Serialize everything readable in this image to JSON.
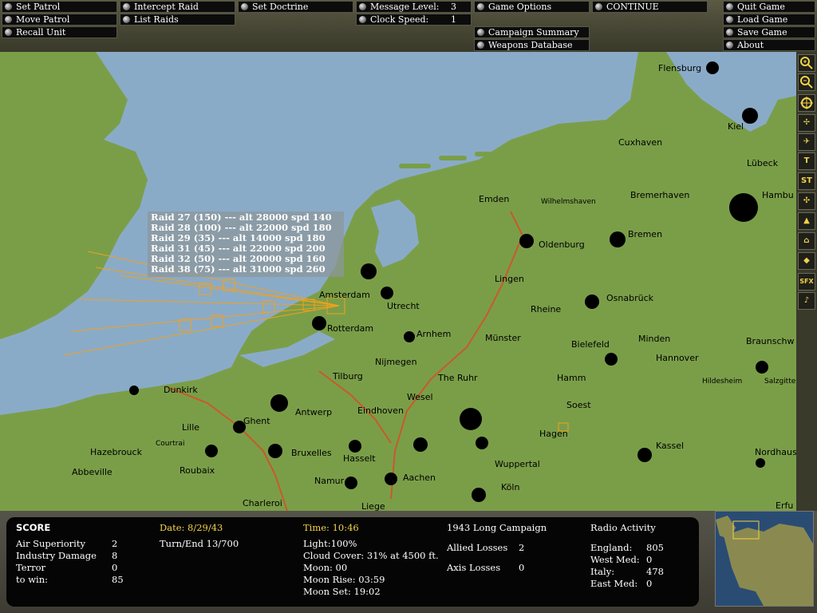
{
  "top_buttons": {
    "set_patrol": "Set Patrol",
    "move_patrol": "Move Patrol",
    "recall_unit": "Recall Unit",
    "intercept_raid": "Intercept Raid",
    "list_raids": "List Raids",
    "set_doctrine": "Set Doctrine",
    "message_level": "Message Level:",
    "message_level_value": "3",
    "clock_speed": "Clock Speed:",
    "clock_speed_value": "1",
    "game_options": "Game Options",
    "continue": "CONTINUE",
    "campaign_summary": "Campaign Summary",
    "weapons_database": "Weapons Database",
    "quit_game": "Quit Game",
    "load_game": "Load Game",
    "save_game": "Save Game",
    "about": "About"
  },
  "map": {
    "cities": {
      "flensburg": "Flensburg",
      "kiel": "Kiel",
      "lubeck": "Lübeck",
      "cuxhaven": "Cuxhaven",
      "hamburg": "Hambu",
      "emden": "Emden",
      "wilhelmshaven": "Wilhelmshaven",
      "bremerhaven": "Bremerhaven",
      "bremen": "Bremen",
      "oldenburg": "Oldenburg",
      "lingen": "Lingen",
      "amsterdam": "Amsterdam",
      "utrecht": "Utrecht",
      "rheine": "Rheine",
      "osnabruck": "Osnabrück",
      "rotterdam": "Rotterdam",
      "arnhem": "Arnhem",
      "munster": "Münster",
      "bielefeld": "Bielefeld",
      "minden": "Minden",
      "braunschweig": "Braunschw",
      "hannover": "Hannover",
      "nijmegen": "Nijmegen",
      "tilburg": "Tilburg",
      "the_ruhr": "The Ruhr",
      "hamm": "Hamm",
      "hildesheim": "Hildesheim",
      "salzgitter": "Salzgitter",
      "dunkirk": "Dunkirk",
      "antwerp": "Antwerp",
      "wesel": "Wesel",
      "eindhoven": "Eindhoven",
      "soest": "Soest",
      "ghent": "Ghent",
      "lille": "Lille",
      "courtrai": "Courtrai",
      "hagen": "Hagen",
      "hazebrouck": "Hazebrouck",
      "bruxelles": "Bruxelles",
      "kassel": "Kassel",
      "roubaix": "Roubaix",
      "hasselt": "Hasselt",
      "wuppertal": "Wuppertal",
      "abbeville": "Abbeville",
      "aachen": "Aachen",
      "nordhausen": "Nordhausen",
      "namur": "Namur",
      "koln": "Köln",
      "charleroi": "Charleroi",
      "liege": "Liege",
      "erfurt": "Erfu"
    }
  },
  "raids": [
    "Raid 27 (150)  --- alt 28000  spd 140",
    "Raid 28 (100)  --- alt 22000  spd 180",
    "Raid 29 (35)  --- alt 14000  spd 180",
    "Raid 31 (45)  --- alt 22000  spd 200",
    "Raid 32 (50)  --- alt 20000  spd 160",
    "Raid 38 (75)  --- alt 31000  spd 260"
  ],
  "sidebar": {
    "zoom_in_icon": "zoom-in-icon",
    "zoom_out_icon": "zoom-out-icon",
    "t_label": "T",
    "st_label": "ST",
    "sfx_label": "SFX"
  },
  "info": {
    "score_title": "SCORE",
    "air_superiority_label": "Air Superiority",
    "air_superiority_value": "2",
    "industry_damage_label": "Industry Damage",
    "industry_damage_value": "8",
    "terror_label": "Terror",
    "terror_value": "0",
    "to_win_label": "to win:",
    "to_win_value": "85",
    "date": "Date: 8/29/43",
    "turn_end": "Turn/End 13/700",
    "time": "Time: 10:46",
    "light": "Light:100%",
    "cloud_cover": "Cloud Cover: 31% at 4500 ft.",
    "moon": "Moon: 00",
    "moon_rise": "Moon Rise: 03:59",
    "moon_set": "Moon Set: 19:02",
    "campaign": "1943 Long Campaign",
    "allied_losses_label": "Allied Losses",
    "allied_losses_value": "2",
    "axis_losses_label": "Axis Losses",
    "axis_losses_value": "0",
    "radio_title": "Radio Activity",
    "england_label": "England:",
    "england_value": "805",
    "west_med_label": "West Med:",
    "west_med_value": "0",
    "italy_label": "Italy:",
    "italy_value": "478",
    "east_med_label": "East Med:",
    "east_med_value": "0"
  },
  "colors": {
    "land": "#7a9e48",
    "sea": "#8aabc7",
    "raid_track": "#f2a01e",
    "front_line": "#c85a2a",
    "accent_yellow": "#f2d24a"
  }
}
